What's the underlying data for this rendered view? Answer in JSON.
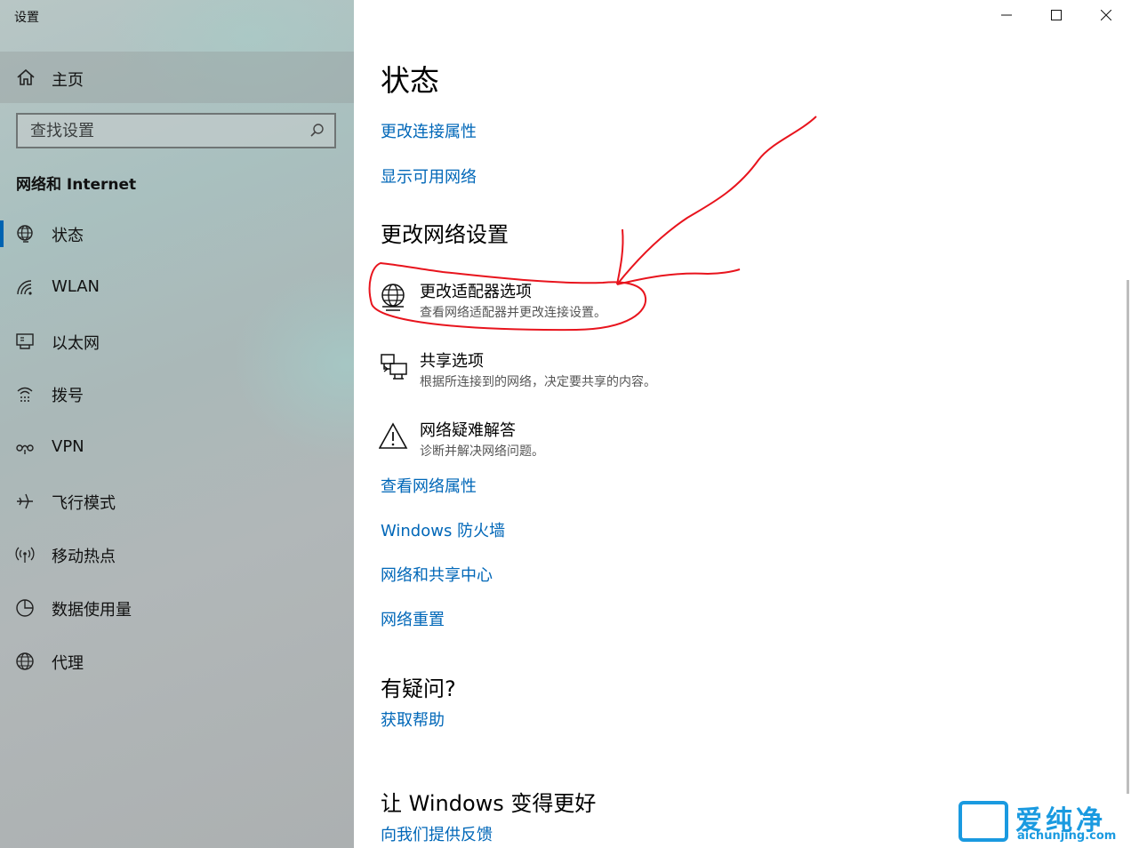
{
  "window": {
    "title": "设置",
    "minimize_icon": "minimize-icon",
    "maximize_icon": "maximize-icon",
    "close_icon": "close-icon"
  },
  "sidebar": {
    "home_label": "主页",
    "search_placeholder": "查找设置",
    "section_title": "网络和 Internet",
    "items": [
      {
        "label": "状态",
        "icon": "globe-status-icon",
        "active": true
      },
      {
        "label": "WLAN",
        "icon": "wifi-icon",
        "active": false
      },
      {
        "label": "以太网",
        "icon": "ethernet-icon",
        "active": false
      },
      {
        "label": "拨号",
        "icon": "dialup-icon",
        "active": false
      },
      {
        "label": "VPN",
        "icon": "vpn-icon",
        "active": false
      },
      {
        "label": "飞行模式",
        "icon": "airplane-icon",
        "active": false
      },
      {
        "label": "移动热点",
        "icon": "hotspot-icon",
        "active": false
      },
      {
        "label": "数据使用量",
        "icon": "data-usage-icon",
        "active": false
      },
      {
        "label": "代理",
        "icon": "proxy-globe-icon",
        "active": false
      }
    ]
  },
  "main": {
    "page_title": "状态",
    "link_change_connection": "更改连接属性",
    "link_show_networks": "显示可用网络",
    "section_change_settings": "更改网络设置",
    "options": [
      {
        "title": "更改适配器选项",
        "desc": "查看网络适配器并更改连接设置。",
        "icon": "adapter-globe-icon"
      },
      {
        "title": "共享选项",
        "desc": "根据所连接到的网络，决定要共享的内容。",
        "icon": "sharing-icon"
      },
      {
        "title": "网络疑难解答",
        "desc": "诊断并解决网络问题。",
        "icon": "warning-icon"
      }
    ],
    "link_network_properties": "查看网络属性",
    "link_firewall": "Windows 防火墙",
    "link_sharing_center": "网络和共享中心",
    "link_network_reset": "网络重置",
    "section_questions": "有疑问?",
    "link_get_help": "获取帮助",
    "section_feedback": "让 Windows 变得更好",
    "link_feedback": "向我们提供反馈"
  },
  "colors": {
    "link": "#0067b8",
    "accent": "#0063b1",
    "annotation": "#e8141d",
    "watermark": "#1a9ae0"
  },
  "watermark": {
    "text": "爱纯净",
    "url": "aichunjing.com"
  }
}
